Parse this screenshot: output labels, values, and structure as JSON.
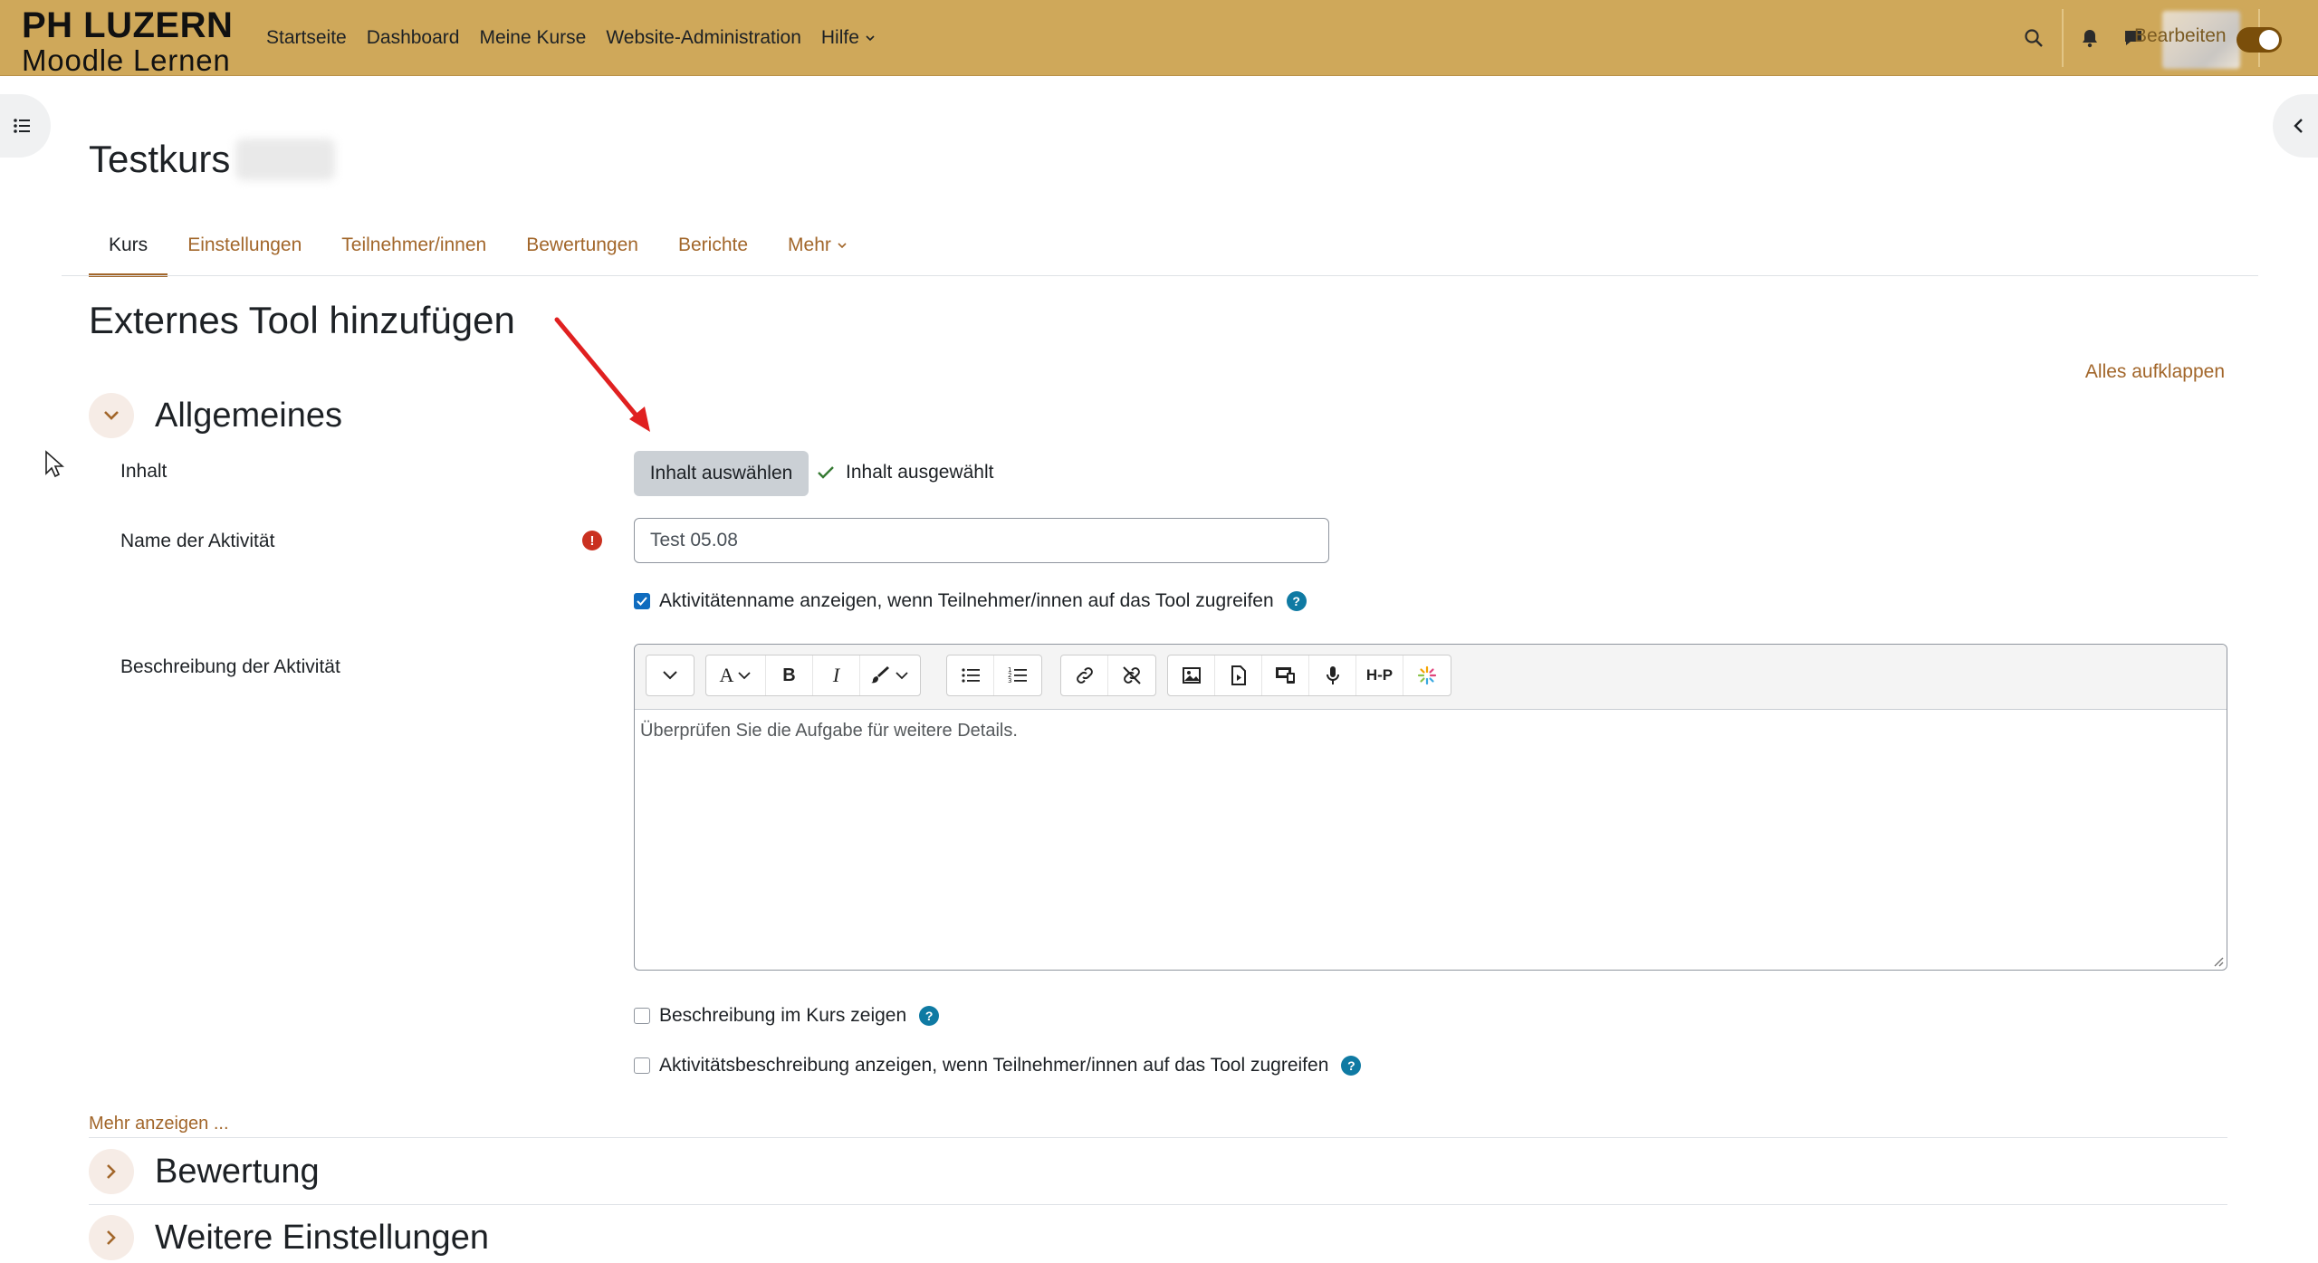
{
  "brand": {
    "line1": "PH LUZERN",
    "line2": "Moodle Lernen"
  },
  "primary_nav": [
    {
      "label": "Startseite"
    },
    {
      "label": "Dashboard"
    },
    {
      "label": "Meine Kurse"
    },
    {
      "label": "Website-Administration"
    },
    {
      "label": "Hilfe",
      "dropdown": true
    }
  ],
  "navbar_right": {
    "edit_mode_label": "Bearbeiten",
    "edit_mode_on": true
  },
  "course": {
    "title": "Testkurs"
  },
  "secondary_nav": [
    {
      "label": "Kurs",
      "active": true
    },
    {
      "label": "Einstellungen"
    },
    {
      "label": "Teilnehmer/innen"
    },
    {
      "label": "Bewertungen"
    },
    {
      "label": "Berichte"
    },
    {
      "label": "Mehr",
      "dropdown": true
    }
  ],
  "page": {
    "title": "Externes Tool hinzufügen",
    "expand_all": "Alles aufklappen"
  },
  "sections": {
    "general": "Allgemeines",
    "grade": "Bewertung",
    "more_settings": "Weitere Einstellungen"
  },
  "form": {
    "content_label": "Inhalt",
    "select_content_button": "Inhalt auswählen",
    "content_selected_text": "Inhalt ausgewählt",
    "name_label": "Name der Aktivität",
    "name_value": "Test 05.08",
    "show_name_checkbox": {
      "label": "Aktivitätenname anzeigen, wenn Teilnehmer/innen auf das Tool zugreifen",
      "checked": true
    },
    "description_label": "Beschreibung der Aktivität",
    "description_value": "Überprüfen Sie die Aufgabe für weitere Details.",
    "show_description_checkbox": {
      "label": "Beschreibung im Kurs zeigen",
      "checked": false
    },
    "show_activity_description_checkbox": {
      "label": "Aktivitätsbeschreibung anzeigen, wenn Teilnehmer/innen auf das Tool zugreifen",
      "checked": false
    },
    "more_link": "Mehr anzeigen ..."
  },
  "editor_toolbar": {
    "bold": "B",
    "italic": "I",
    "h5p": "H-P",
    "font_letter": "A"
  },
  "colors": {
    "navbar": "#cfa85a",
    "link": "#a2662a",
    "required": "#ca3120",
    "help": "#0f7aa3",
    "checkbox": "#0f6cbf",
    "annotation_arrow": "#e02020"
  }
}
